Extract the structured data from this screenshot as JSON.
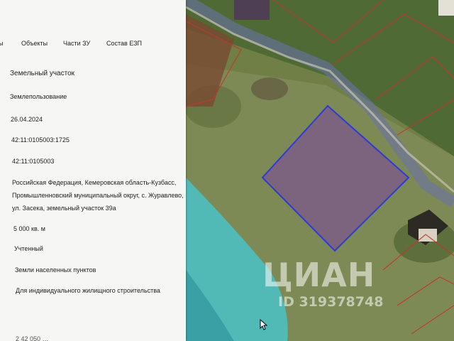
{
  "tabs": [
    "ы",
    "Объекты",
    "Части ЗУ",
    "Состав ЕЗП"
  ],
  "info": {
    "type": "Земельный участок",
    "category": "Землепользование",
    "date": "26.04.2024",
    "cadastral_number": "42:11:0105003:1725",
    "quarter": "42:11:0105003",
    "address": "Российская Федерация, Кемеровская область-Кузбасс, Промышленновский муниципальный округ, с. Журавлево, ул. Засека, земельный участок 39а",
    "area": "5 000 кв. м",
    "status": "Учтенный",
    "land_category": "Земли населенных пунктов",
    "permitted_use": "Для индивидуального жилищного строительства",
    "cut_off": "2 42 050 …"
  },
  "watermark": {
    "logo": "ЦИАН",
    "id": "ID 319378748"
  },
  "colors": {
    "parcel_fill": "#7c5a8a",
    "parcel_border": "#2b3bd8",
    "water": "#49c2c8",
    "road": "#6a73a8",
    "plot_lines": "#c0392b",
    "panel_bg": "#f6f6f4"
  }
}
